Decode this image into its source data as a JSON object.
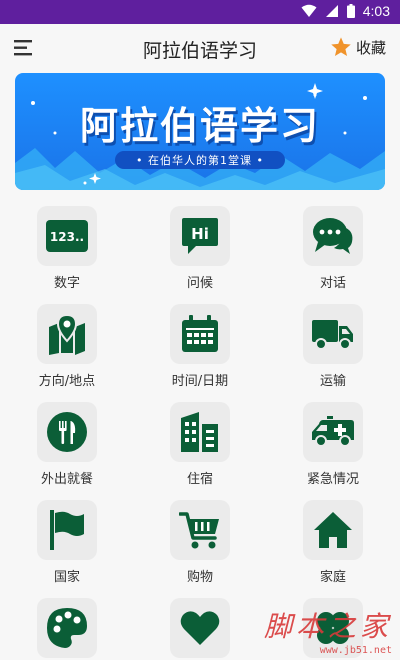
{
  "status_bar": {
    "time": "4:03",
    "background": "#5f1f9e"
  },
  "app_bar": {
    "title": "阿拉伯语学习",
    "favorite_label": "收藏",
    "favorite_icon": "star-icon",
    "menu_icon": "menu-icon"
  },
  "banner": {
    "title": "阿拉伯语学习",
    "subtitle": "• 在伯华人的第1堂课 •"
  },
  "accent_color": "#0b5e37",
  "categories": [
    {
      "label": "数字",
      "icon": "numbers-icon"
    },
    {
      "label": "问候",
      "icon": "hi-chat-icon"
    },
    {
      "label": "对话",
      "icon": "conversation-icon"
    },
    {
      "label": "方向/地点",
      "icon": "map-pin-icon"
    },
    {
      "label": "时间/日期",
      "icon": "calendar-icon"
    },
    {
      "label": "运输",
      "icon": "truck-icon"
    },
    {
      "label": "外出就餐",
      "icon": "restaurant-icon"
    },
    {
      "label": "住宿",
      "icon": "building-icon"
    },
    {
      "label": "紧急情况",
      "icon": "ambulance-icon"
    },
    {
      "label": "国家",
      "icon": "flag-icon"
    },
    {
      "label": "购物",
      "icon": "shopping-cart-icon"
    },
    {
      "label": "家庭",
      "icon": "home-icon"
    },
    {
      "label": "",
      "icon": "palette-icon"
    },
    {
      "label": "",
      "icon": "heart-icon"
    },
    {
      "label": "",
      "icon": "clover-icon"
    }
  ],
  "watermark": {
    "text": "脚本之家",
    "url": "www.jb51.net"
  }
}
